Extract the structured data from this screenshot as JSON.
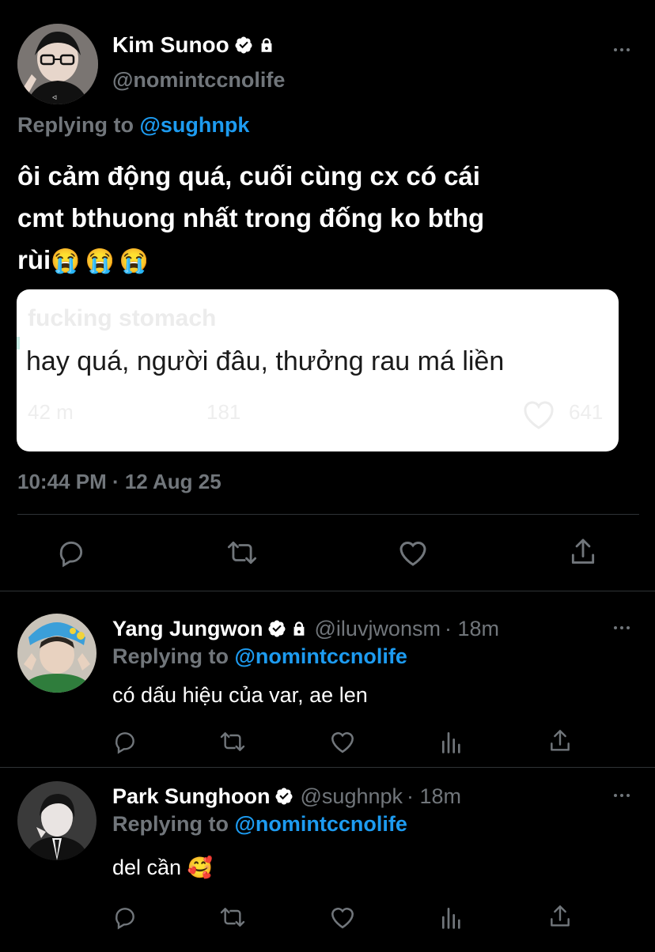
{
  "main_tweet": {
    "display_name": "Kim Sunoo",
    "handle": "@nomintccnolife",
    "replying_prefix": "Replying to",
    "replying_handle": "@sughnpk",
    "text_line1": "ôi cảm động quá, cuối cùng cx có cái",
    "text_line2": "cmt bthuong nhất trong đống ko bthg",
    "text_line3": "rùi",
    "emojis": "😭😭😭",
    "quoted_comment": {
      "faded_top": "fucking stomach",
      "text": "hay quá, người đâu, thưởng rau má liền",
      "faded_bottom_left": "42 m",
      "faded_bottom_mid": "181",
      "faded_like_count": "641"
    },
    "timestamp": "10:44 PM · 12 Aug 25"
  },
  "replies": [
    {
      "display_name": "Yang Jungwon",
      "handle": "@iluvjwonsm",
      "time": "· 18m",
      "replying_prefix": "Replying to",
      "replying_handle": "@nomintccnolife",
      "text": "có dấu hiệu của var, ae len",
      "emoji": ""
    },
    {
      "display_name": "Park Sunghoon",
      "handle": "@sughnpk",
      "time": "· 18m",
      "replying_prefix": "Replying to",
      "replying_handle": "@nomintccnolife",
      "text": "del cần",
      "emoji": "🥰"
    }
  ],
  "icons": {
    "reply": "reply-icon",
    "retweet": "retweet-icon",
    "like": "like-icon",
    "share": "share-icon",
    "analytics": "analytics-icon",
    "verified": "verified-badge-icon",
    "lock": "lock-icon",
    "more": "more-icon"
  },
  "colors": {
    "background": "#000000",
    "accent": "#1d9bf0",
    "muted": "#71767b",
    "divider": "#2f3336"
  }
}
